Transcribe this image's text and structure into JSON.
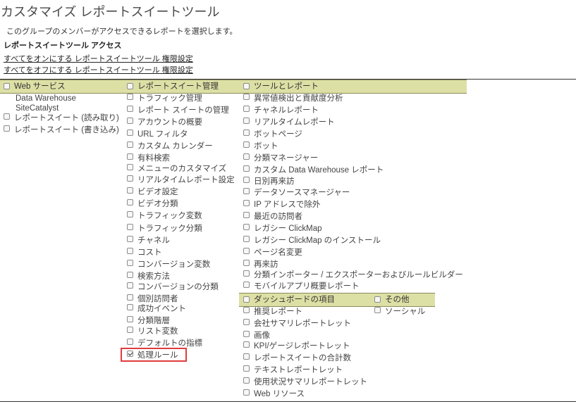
{
  "page": {
    "title": "カスタマイズ レポートスイートツール",
    "description": "このグループのメンバーがアクセスできるレポートを選択します。",
    "section_heading": "レポートスイートツール アクセス",
    "select_all_link": "すべてをオンにする レポートスイートツール 権限設定",
    "deselect_all_link": "すべてをオフにする レポートスイートツール 権限設定"
  },
  "columns": {
    "web_services": {
      "header": "Web サービス",
      "items": [
        {
          "label": "Data Warehouse",
          "checkbox": false,
          "checked": false
        },
        {
          "label": "SiteCatalyst",
          "checkbox": false,
          "checked": false
        },
        {
          "label": "レポートスイート (読み取り)",
          "checkbox": true,
          "checked": false
        },
        {
          "label": "レポートスイート (書き込み)",
          "checkbox": true,
          "checked": false
        }
      ]
    },
    "report_suite_admin": {
      "header": "レポートスイート管理",
      "items": [
        {
          "label": "トラフィック管理",
          "checked": false
        },
        {
          "label": "レポート スイートの管理",
          "checked": false
        },
        {
          "label": "アカウントの概要",
          "checked": false
        },
        {
          "label": "URL フィルタ",
          "checked": false
        },
        {
          "label": "カスタム カレンダー",
          "checked": false
        },
        {
          "label": "有料検索",
          "checked": false
        },
        {
          "label": "メニューのカスタマイズ",
          "checked": false
        },
        {
          "label": "リアルタイムレポート設定",
          "checked": false
        },
        {
          "label": "ビデオ設定",
          "checked": false
        },
        {
          "label": "ビデオ分類",
          "checked": false
        },
        {
          "label": "トラフィック変数",
          "checked": false
        },
        {
          "label": "トラフィック分類",
          "checked": false
        },
        {
          "label": "チャネル",
          "checked": false
        },
        {
          "label": "コスト",
          "checked": false
        },
        {
          "label": "コンバージョン変数",
          "checked": false
        },
        {
          "label": "検索方法",
          "checked": false
        },
        {
          "label": "コンバージョンの分類",
          "checked": false
        },
        {
          "label": "個別訪問者",
          "checked": false
        },
        {
          "label": "成功イベント",
          "checked": false
        },
        {
          "label": "分類階層",
          "checked": false
        },
        {
          "label": "リスト変数",
          "checked": false
        },
        {
          "label": "デフォルトの指標",
          "checked": false
        },
        {
          "label": "処理ルール",
          "checked": true
        }
      ]
    },
    "tools_reports": {
      "header": "ツールとレポート",
      "items": [
        {
          "label": "異常値検出と貢献度分析",
          "checked": false
        },
        {
          "label": "チャネルレポート",
          "checked": false
        },
        {
          "label": "リアルタイムレポート",
          "checked": false
        },
        {
          "label": "ボットページ",
          "checked": false
        },
        {
          "label": "ボット",
          "checked": false
        },
        {
          "label": "分類マネージャー",
          "checked": false
        },
        {
          "label": "カスタム Data Warehouse レポート",
          "checked": false
        },
        {
          "label": "日別再来訪",
          "checked": false
        },
        {
          "label": "データソースマネージャー",
          "checked": false
        },
        {
          "label": "IP アドレスで除外",
          "checked": false
        },
        {
          "label": "最近の訪問者",
          "checked": false
        },
        {
          "label": "レガシー ClickMap",
          "checked": false
        },
        {
          "label": "レガシー ClickMap のインストール",
          "checked": false
        },
        {
          "label": "ページ名変更",
          "checked": false
        },
        {
          "label": "再来訪",
          "checked": false
        },
        {
          "label": "分類インポーター / エクスポーターおよびルールビルダー",
          "checked": false
        },
        {
          "label": "モバイルアプリ概要レポート",
          "checked": false
        }
      ]
    },
    "dashboard": {
      "header": "ダッシュボードの項目",
      "items": [
        {
          "label": "推奨レポート",
          "checked": false
        },
        {
          "label": "会社サマリレポートレット",
          "checked": false
        },
        {
          "label": "画像",
          "checked": false
        },
        {
          "label": "KPI/ゲージレポートレット",
          "checked": false
        },
        {
          "label": "レポートスイートの合計数",
          "checked": false
        },
        {
          "label": "テキストレポートレット",
          "checked": false
        },
        {
          "label": "使用状況サマリレポートレット",
          "checked": false
        },
        {
          "label": "Web リソース",
          "checked": false
        }
      ]
    },
    "other": {
      "header": "その他",
      "items": [
        {
          "label": "ソーシャル",
          "checked": false
        }
      ]
    }
  },
  "colors": {
    "header_bar": "#dde0a5",
    "highlight": "#e03c3c"
  }
}
